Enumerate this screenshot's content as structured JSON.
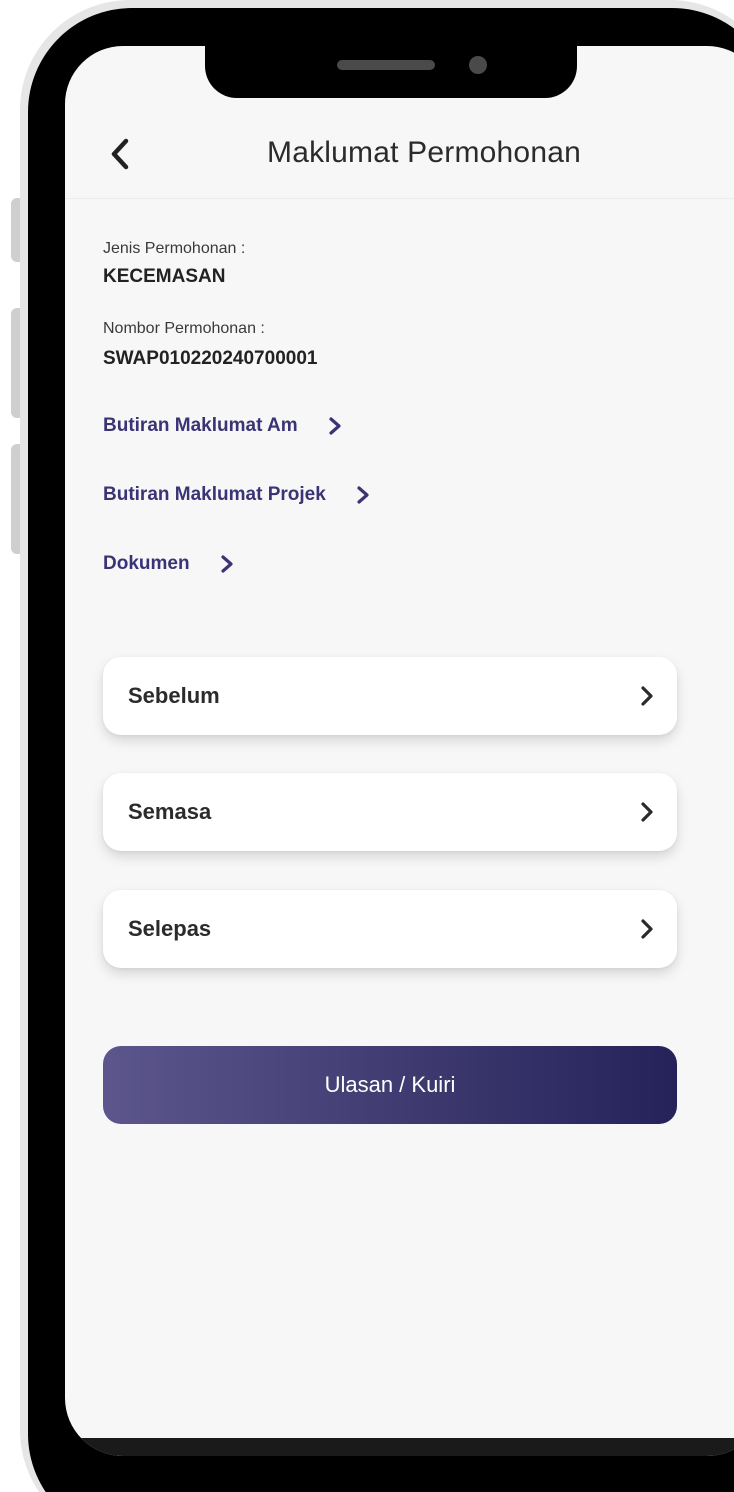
{
  "header": {
    "title": "Maklumat Permohonan",
    "back_icon": "chevron-left-icon"
  },
  "details": {
    "jenis_label": "Jenis Permohonan :",
    "jenis_value": "KECEMASAN",
    "nombor_label": "Nombor Permohonan :",
    "nombor_value": "SWAP010220240700001"
  },
  "links": [
    {
      "label": "Butiran Maklumat Am",
      "icon": "chevron-right-icon"
    },
    {
      "label": "Butiran Maklumat Projek",
      "icon": "chevron-right-icon"
    },
    {
      "label": "Dokumen",
      "icon": "chevron-right-icon"
    }
  ],
  "stages": [
    {
      "label": "Sebelum",
      "icon": "chevron-right-icon"
    },
    {
      "label": "Semasa",
      "icon": "chevron-right-icon"
    },
    {
      "label": "Selepas",
      "icon": "chevron-right-icon"
    }
  ],
  "action": {
    "label": "Ulasan / Kuiri"
  },
  "colors": {
    "link": "#3a3475",
    "button_gradient_start": "#5c568d",
    "button_gradient_end": "#25225a",
    "screen_bg": "#f7f7f7"
  }
}
